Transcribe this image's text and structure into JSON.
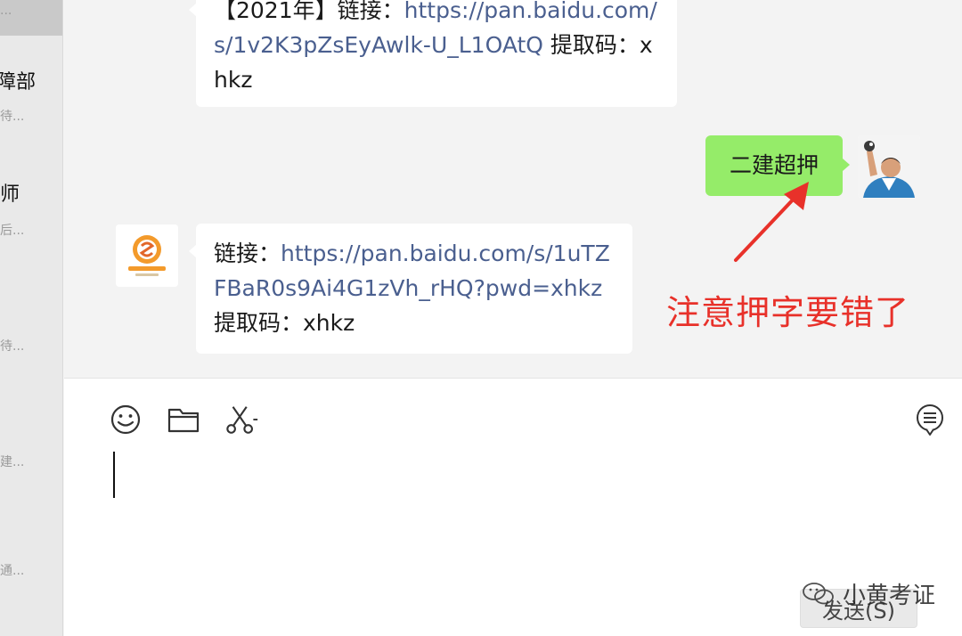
{
  "sidebar": {
    "items": [
      {
        "name": "",
        "preview": "..."
      },
      {
        "name": "障部",
        "preview": "待..."
      },
      {
        "name": "师",
        "preview": "后..."
      },
      {
        "name": "",
        "preview": "待..."
      },
      {
        "name": "",
        "preview": "建..."
      },
      {
        "name": "",
        "preview": "通..."
      }
    ]
  },
  "messages": {
    "m1": {
      "prefix": "【2021年】链接：",
      "url": "https://pan.baidu.com/s/1v2K3pZsEyAwlk-U_L1OAtQ",
      "code_label": " 提取码：xhkz"
    },
    "m2": {
      "text": "二建超押"
    },
    "m3": {
      "prefix": "链接：",
      "url": "https://pan.baidu.com/s/1uTZFBaR0s9Ai4G1zVh_rHQ?pwd=xhkz",
      "code_label": " 提取码：xhkz"
    }
  },
  "annotation": {
    "text": "注意押字要错了",
    "color": "#e8312a"
  },
  "composer": {
    "tools": [
      "emoji-icon",
      "folder-icon",
      "scissors-icon",
      "chat-history-icon"
    ],
    "send_label": "发送(S)"
  },
  "watermark": {
    "text": "小黄考证"
  },
  "colors": {
    "outgoing_bubble": "#95ec69",
    "link": "#4a5f8f",
    "accent_red": "#e8312a"
  }
}
